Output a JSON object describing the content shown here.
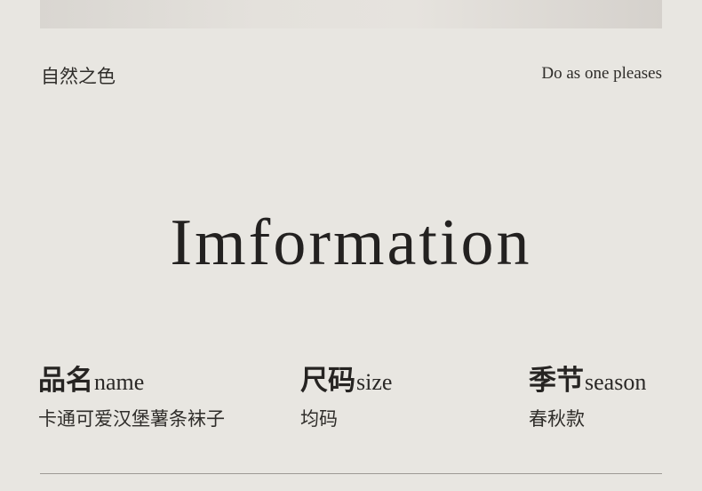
{
  "header": {
    "left_text": "自然之色",
    "right_text": "Do as one pleases"
  },
  "heading": "Imformation",
  "info": {
    "name": {
      "label_zh": "品名",
      "label_en": "name",
      "value": "卡通可爱汉堡薯条袜子"
    },
    "size": {
      "label_zh": "尺码",
      "label_en": "size",
      "value": "均码"
    },
    "season": {
      "label_zh": "季节",
      "label_en": "season",
      "value": "春秋款"
    }
  }
}
